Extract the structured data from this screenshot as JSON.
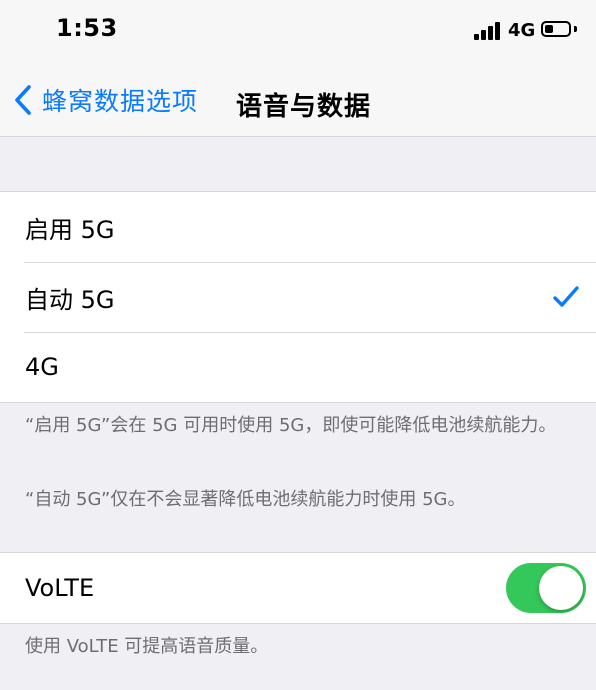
{
  "status_bar": {
    "time": "1:53",
    "network": "4G",
    "signal_bars": 4,
    "battery_level": 0.35
  },
  "nav": {
    "back_label": "蜂窝数据选项",
    "title": "语音与数据"
  },
  "network_options": {
    "items": [
      {
        "label": "启用 5G",
        "selected": false
      },
      {
        "label": "自动 5G",
        "selected": true
      },
      {
        "label": "4G",
        "selected": false
      }
    ]
  },
  "notes": {
    "enable_5g": "“启用 5G”会在 5G 可用时使用 5G，即使可能降低电池续航能力。",
    "auto_5g": "“自动 5G”仅在不会显著降低电池续航能力时使用 5G。"
  },
  "volte": {
    "label": "VoLTE",
    "enabled": true,
    "note": "使用 VoLTE 可提高语音质量。"
  },
  "colors": {
    "accent": "#0a7aff",
    "toggle_on": "#34c759",
    "background": "#efeff4",
    "footer_text": "#6d6d72"
  },
  "icons": {
    "back": "chevron-left-icon",
    "check": "checkmark-icon",
    "signal": "cellular-signal-icon",
    "battery": "battery-icon"
  }
}
